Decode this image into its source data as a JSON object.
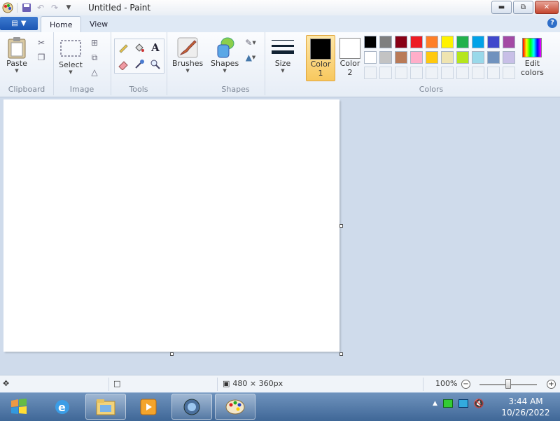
{
  "window": {
    "title": "Untitled - Paint"
  },
  "tabs": [
    {
      "label": "Home"
    },
    {
      "label": "View"
    }
  ],
  "ribbon": {
    "clipboard": {
      "paste_label": "Paste",
      "group_label": "Clipboard"
    },
    "image": {
      "select_label": "Select",
      "group_label": "Image"
    },
    "tools": {
      "group_label": "Tools"
    },
    "brushes": {
      "label": "Brushes"
    },
    "shapes": {
      "label": "Shapes",
      "group_label": "Shapes"
    },
    "size": {
      "label": "Size"
    },
    "colors": {
      "color1_label": "Color\n1",
      "color1_a": "Color",
      "color1_b": "1",
      "color2_a": "Color",
      "color2_b": "2",
      "edit_a": "Edit",
      "edit_b": "colors",
      "group_label": "Colors",
      "color1_value": "#000000",
      "color2_value": "#ffffff",
      "palette_row1": [
        "#000000",
        "#7f7f7f",
        "#880015",
        "#ed1c24",
        "#ff7f27",
        "#fff200",
        "#22b14c",
        "#00a2e8",
        "#3f48cc",
        "#a349a4"
      ],
      "palette_row2": [
        "#ffffff",
        "#c3c3c3",
        "#b97a57",
        "#ffaec9",
        "#ffc90e",
        "#efe4b0",
        "#b5e61d",
        "#99d9ea",
        "#7092be",
        "#c8bfe7"
      ]
    }
  },
  "statusbar": {
    "dimensions": "480 × 360px",
    "zoom": "100%",
    "zoom_level": 0.5
  },
  "taskbar": {
    "time": "3:44 AM",
    "date": "10/26/2022"
  }
}
